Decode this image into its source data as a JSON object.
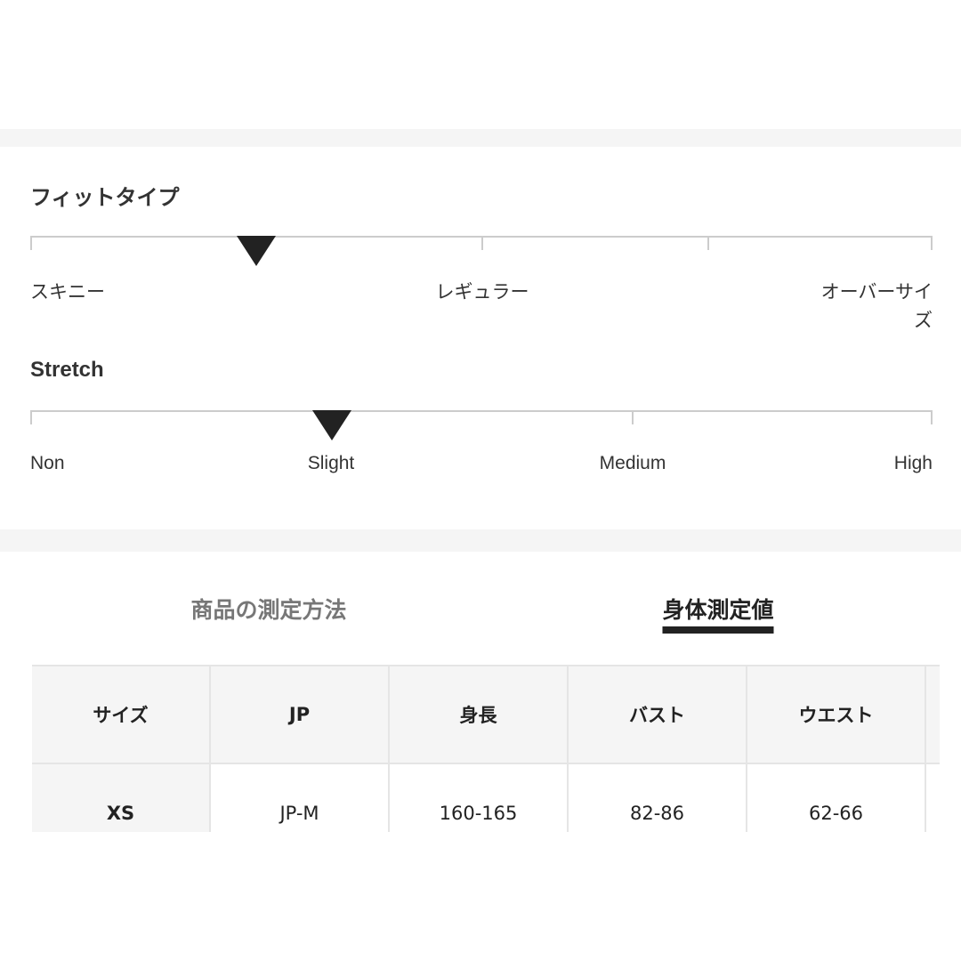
{
  "fit_type": {
    "title": "フィットタイプ",
    "labels": [
      "スキニー",
      "レギュラー",
      "オーバーサイズ"
    ],
    "value_fraction": 0.25
  },
  "stretch": {
    "title": "Stretch",
    "labels": [
      "Non",
      "Slight",
      "Medium",
      "High"
    ],
    "selected": "Slight"
  },
  "tabs": [
    {
      "label": "商品の測定方法",
      "active": false
    },
    {
      "label": "身体測定値",
      "active": true
    }
  ],
  "table": {
    "headers": [
      "サイズ",
      "JP",
      "身長",
      "バスト",
      "ウエスト"
    ],
    "rows": [
      [
        "XS",
        "JP-M",
        "160-165",
        "82-86",
        "62-66"
      ]
    ]
  },
  "colors": {
    "accent": "#222222",
    "band": "#f5f5f5",
    "track": "#cccccc"
  }
}
